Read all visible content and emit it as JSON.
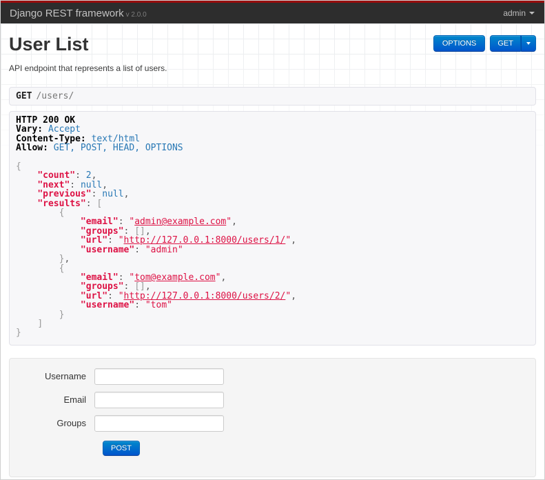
{
  "navbar": {
    "brand": "Django REST framework",
    "version": "v 2.0.0",
    "user_menu_label": "admin"
  },
  "header": {
    "title": "User List",
    "description": "API endpoint that represents a list of users."
  },
  "toolbar": {
    "options_label": "OPTIONS",
    "get_label": "GET"
  },
  "request_bar": {
    "method": "GET",
    "path": "/users/"
  },
  "response": {
    "lines": [
      [
        {
          "c": "hdr",
          "t": "HTTP 200 OK"
        }
      ],
      [
        {
          "c": "hdr",
          "t": "Vary:"
        },
        {
          "c": "pln",
          "t": " "
        },
        {
          "c": "lit",
          "t": "Accept"
        }
      ],
      [
        {
          "c": "hdr",
          "t": "Content-Type:"
        },
        {
          "c": "pln",
          "t": " "
        },
        {
          "c": "lit",
          "t": "text/html"
        }
      ],
      [
        {
          "c": "hdr",
          "t": "Allow:"
        },
        {
          "c": "pln",
          "t": " "
        },
        {
          "c": "lit",
          "t": "GET, POST, HEAD, OPTIONS"
        }
      ],
      [],
      [
        {
          "c": "pun",
          "t": "{"
        }
      ],
      [
        {
          "c": "pln",
          "t": "    "
        },
        {
          "c": "key",
          "t": "\"count\""
        },
        {
          "c": "pln",
          "t": ": "
        },
        {
          "c": "num",
          "t": "2"
        },
        {
          "c": "pln",
          "t": ","
        }
      ],
      [
        {
          "c": "pln",
          "t": "    "
        },
        {
          "c": "key",
          "t": "\"next\""
        },
        {
          "c": "pln",
          "t": ": "
        },
        {
          "c": "lit",
          "t": "null"
        },
        {
          "c": "pln",
          "t": ","
        }
      ],
      [
        {
          "c": "pln",
          "t": "    "
        },
        {
          "c": "key",
          "t": "\"previous\""
        },
        {
          "c": "pln",
          "t": ": "
        },
        {
          "c": "lit",
          "t": "null"
        },
        {
          "c": "pln",
          "t": ","
        }
      ],
      [
        {
          "c": "pln",
          "t": "    "
        },
        {
          "c": "key",
          "t": "\"results\""
        },
        {
          "c": "pln",
          "t": ": "
        },
        {
          "c": "pun",
          "t": "["
        }
      ],
      [
        {
          "c": "pln",
          "t": "        "
        },
        {
          "c": "pun",
          "t": "{"
        }
      ],
      [
        {
          "c": "pln",
          "t": "            "
        },
        {
          "c": "key",
          "t": "\"email\""
        },
        {
          "c": "pln",
          "t": ": "
        },
        {
          "c": "str",
          "t": "\""
        },
        {
          "c": "link",
          "t": "admin@example.com"
        },
        {
          "c": "str",
          "t": "\""
        },
        {
          "c": "pln",
          "t": ","
        }
      ],
      [
        {
          "c": "pln",
          "t": "            "
        },
        {
          "c": "key",
          "t": "\"groups\""
        },
        {
          "c": "pln",
          "t": ": "
        },
        {
          "c": "pun",
          "t": "[]"
        },
        {
          "c": "pln",
          "t": ","
        }
      ],
      [
        {
          "c": "pln",
          "t": "            "
        },
        {
          "c": "key",
          "t": "\"url\""
        },
        {
          "c": "pln",
          "t": ": "
        },
        {
          "c": "str",
          "t": "\""
        },
        {
          "c": "link",
          "t": "http://127.0.0.1:8000/users/1/"
        },
        {
          "c": "str",
          "t": "\""
        },
        {
          "c": "pln",
          "t": ","
        }
      ],
      [
        {
          "c": "pln",
          "t": "            "
        },
        {
          "c": "key",
          "t": "\"username\""
        },
        {
          "c": "pln",
          "t": ": "
        },
        {
          "c": "str",
          "t": "\"admin\""
        }
      ],
      [
        {
          "c": "pln",
          "t": "        "
        },
        {
          "c": "pun",
          "t": "}"
        },
        {
          "c": "pln",
          "t": ","
        }
      ],
      [
        {
          "c": "pln",
          "t": "        "
        },
        {
          "c": "pun",
          "t": "{"
        }
      ],
      [
        {
          "c": "pln",
          "t": "            "
        },
        {
          "c": "key",
          "t": "\"email\""
        },
        {
          "c": "pln",
          "t": ": "
        },
        {
          "c": "str",
          "t": "\""
        },
        {
          "c": "link",
          "t": "tom@example.com"
        },
        {
          "c": "str",
          "t": "\""
        },
        {
          "c": "pln",
          "t": ","
        }
      ],
      [
        {
          "c": "pln",
          "t": "            "
        },
        {
          "c": "key",
          "t": "\"groups\""
        },
        {
          "c": "pln",
          "t": ": "
        },
        {
          "c": "pun",
          "t": "[]"
        },
        {
          "c": "pln",
          "t": ","
        }
      ],
      [
        {
          "c": "pln",
          "t": "            "
        },
        {
          "c": "key",
          "t": "\"url\""
        },
        {
          "c": "pln",
          "t": ": "
        },
        {
          "c": "str",
          "t": "\""
        },
        {
          "c": "link",
          "t": "http://127.0.0.1:8000/users/2/"
        },
        {
          "c": "str",
          "t": "\""
        },
        {
          "c": "pln",
          "t": ","
        }
      ],
      [
        {
          "c": "pln",
          "t": "            "
        },
        {
          "c": "key",
          "t": "\"username\""
        },
        {
          "c": "pln",
          "t": ": "
        },
        {
          "c": "str",
          "t": "\"tom\""
        }
      ],
      [
        {
          "c": "pln",
          "t": "        "
        },
        {
          "c": "pun",
          "t": "}"
        }
      ],
      [
        {
          "c": "pln",
          "t": "    "
        },
        {
          "c": "pun",
          "t": "]"
        }
      ],
      [
        {
          "c": "pun",
          "t": "}"
        }
      ]
    ]
  },
  "form": {
    "fields": [
      {
        "label": "Username",
        "value": ""
      },
      {
        "label": "Email",
        "value": ""
      },
      {
        "label": "Groups",
        "value": ""
      }
    ],
    "submit_label": "POST"
  },
  "colors": {
    "top_stripe": "#970c0c",
    "navbar_bg": "#2d2d2d",
    "accent_button_blue": "#0077cc",
    "json_string_red": "#dd1144",
    "json_literal_blue": "#2878b5",
    "panel_bg": "#f7f7f9",
    "panel_border": "#e1e1e8"
  }
}
